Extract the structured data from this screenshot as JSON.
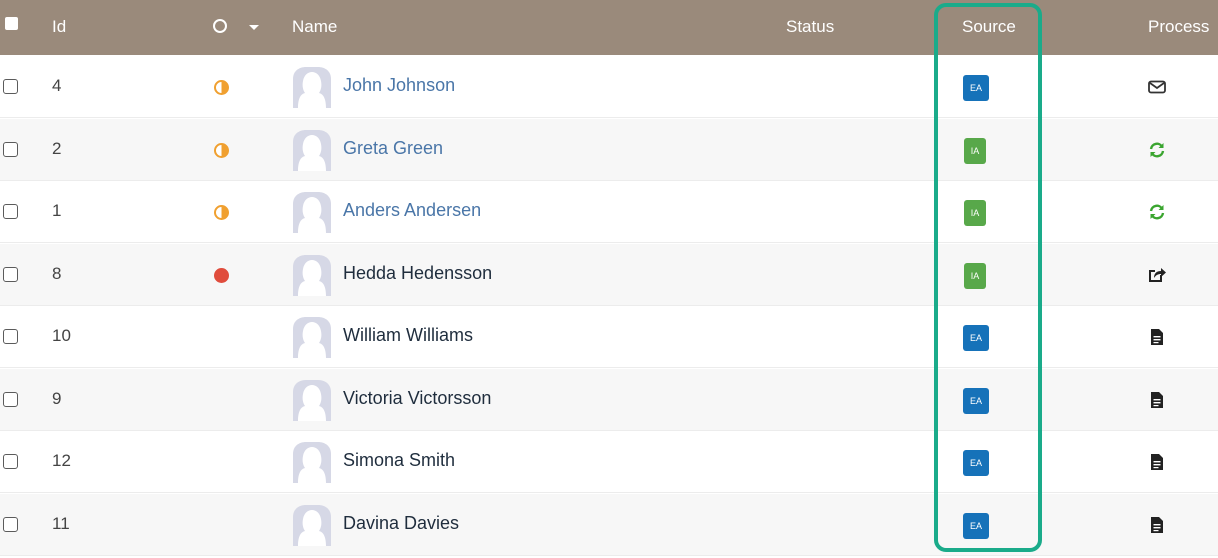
{
  "header": {
    "id": "Id",
    "name": "Name",
    "status": "Status",
    "source": "Source",
    "process": "Process"
  },
  "rows": [
    {
      "id": "4",
      "status": "half",
      "name": "John Johnson",
      "link": true,
      "source": "EA",
      "process": "envelope-icon"
    },
    {
      "id": "2",
      "status": "half",
      "name": "Greta Green",
      "link": true,
      "source": "IA",
      "process": "refresh-icon"
    },
    {
      "id": "1",
      "status": "half",
      "name": "Anders Andersen",
      "link": true,
      "source": "IA",
      "process": "refresh-icon"
    },
    {
      "id": "8",
      "status": "red",
      "name": "Hedda Hedensson",
      "link": false,
      "source": "IA",
      "process": "share-icon"
    },
    {
      "id": "10",
      "status": "none",
      "name": "William Williams",
      "link": false,
      "source": "EA",
      "process": "document-icon"
    },
    {
      "id": "9",
      "status": "none",
      "name": "Victoria Victorsson",
      "link": false,
      "source": "EA",
      "process": "document-icon"
    },
    {
      "id": "12",
      "status": "none",
      "name": "Simona Smith",
      "link": false,
      "source": "EA",
      "process": "document-icon"
    },
    {
      "id": "11",
      "status": "none",
      "name": "Davina Davies",
      "link": false,
      "source": "EA",
      "process": "document-icon"
    }
  ],
  "colors": {
    "header_bg": "#9a8a7b",
    "link": "#4a76a8",
    "ea_badge": "#1672b9",
    "ia_badge": "#58a84a",
    "status_half": "#f0a030",
    "status_red": "#e04c3c",
    "highlight": "#1aab8a"
  }
}
